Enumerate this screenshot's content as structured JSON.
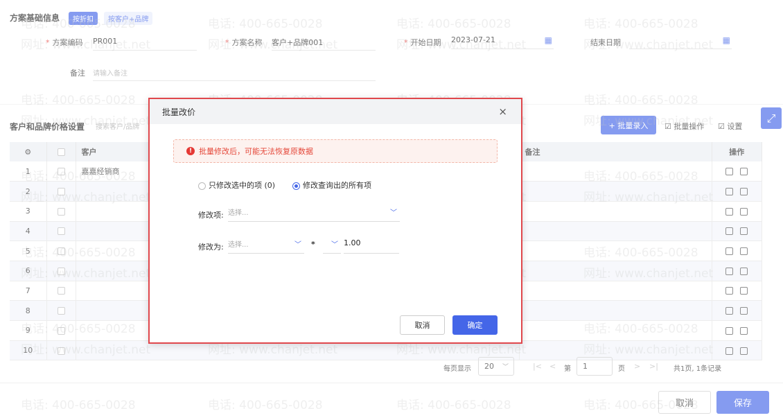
{
  "basic": {
    "title": "方案基础信息",
    "chip_discount": "按折扣",
    "chip_customer_brand": "按客户+品牌",
    "code_label": "方案编码",
    "code_value": "PR001",
    "name_label": "方案名称",
    "name_value": "客户+品牌001",
    "start_label": "开始日期",
    "start_value": "2023-07-21",
    "end_label": "结束日期",
    "remark_label": "备注",
    "remark_placeholder": "请输入备注",
    "required_mark": "*"
  },
  "price": {
    "title": "客户和品牌价格设置",
    "search_placeholder": "搜索客户/品牌",
    "batch_entry": "+ 批量录入",
    "batch_ops": "批量操作",
    "settings": "设置"
  },
  "table": {
    "col_customer": "客户",
    "col_remark": "备注",
    "col_ops": "操作",
    "rows": [
      {
        "no": "1",
        "customer": "嘉嘉经销商"
      },
      {
        "no": "2",
        "customer": ""
      },
      {
        "no": "3",
        "customer": ""
      },
      {
        "no": "4",
        "customer": ""
      },
      {
        "no": "5",
        "customer": ""
      },
      {
        "no": "6",
        "customer": ""
      },
      {
        "no": "7",
        "customer": ""
      },
      {
        "no": "8",
        "customer": ""
      },
      {
        "no": "9",
        "customer": ""
      },
      {
        "no": "10",
        "customer": ""
      }
    ]
  },
  "pagination": {
    "per_page_label": "每页显示",
    "per_page": "20",
    "page_prefix": "第",
    "page": "1",
    "page_suffix": "页",
    "summary": "共1页, 1条记录"
  },
  "footer": {
    "cancel": "取消",
    "save": "保存"
  },
  "modal": {
    "title": "批量改价",
    "warning": "批量修改后，可能无法恢复原数据",
    "radio_selected": "只修改选中的项 (0)",
    "radio_all": "修改查询出的所有项",
    "modify_item_label": "修改项:",
    "modify_item_placeholder": "选择...",
    "modify_to_label": "修改为:",
    "modify_to_placeholder": "选择...",
    "operator": "*",
    "factor": "1.00",
    "cancel": "取消",
    "confirm": "确定"
  },
  "watermark": {
    "phone": "电话: 400-665-0028",
    "site": "网址: www.chanjet.net"
  },
  "colors": {
    "primary": "#4466e8",
    "danger": "#e53935"
  }
}
